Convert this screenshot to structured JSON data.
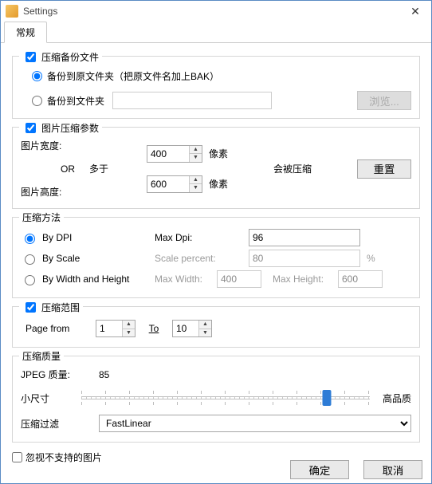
{
  "window": {
    "title": "Settings",
    "close_glyph": "✕"
  },
  "tabs": {
    "general": "常规"
  },
  "backup": {
    "group_label": "压缩备份文件",
    "opt_same_folder": "备份到原文件夹（把原文件名加上BAK）",
    "opt_folder": "备份到文件夹",
    "folder_value": "",
    "browse_btn": "浏览..."
  },
  "img_params": {
    "group_label": "图片压缩参数",
    "width_label": "图片宽度:",
    "or_label": "OR",
    "more_than": "多于",
    "height_label": "图片高度:",
    "width_value": "400",
    "height_value": "600",
    "pixel": "像素",
    "will_compress": "会被压缩",
    "reset_btn": "重置"
  },
  "method": {
    "group_label": "压缩方法",
    "by_dpi": "By DPI",
    "by_scale": "By Scale",
    "by_wh": "By Width and Height",
    "max_dpi_label": "Max Dpi:",
    "max_dpi_value": "96",
    "scale_percent_label": "Scale percent:",
    "scale_percent_value": "80",
    "percent_sign": "%",
    "max_width_label": "Max Width:",
    "max_width_value": "400",
    "max_height_label": "Max Height:",
    "max_height_value": "600"
  },
  "range": {
    "group_label": "压缩范围",
    "page_from": "Page from",
    "to_label": "To",
    "from_value": "1",
    "to_value": "10"
  },
  "quality": {
    "group_label": "压缩质量",
    "jpeg_label": "JPEG 质量:",
    "jpeg_value": "85",
    "low_label": "小尺寸",
    "high_label": "高品质",
    "slider_position_percent": 85,
    "filter_label": "压缩过滤",
    "filter_value": "FastLinear"
  },
  "ignore_unsupported": "忽视不支持的图片",
  "buttons": {
    "ok": "确定",
    "cancel": "取消"
  }
}
